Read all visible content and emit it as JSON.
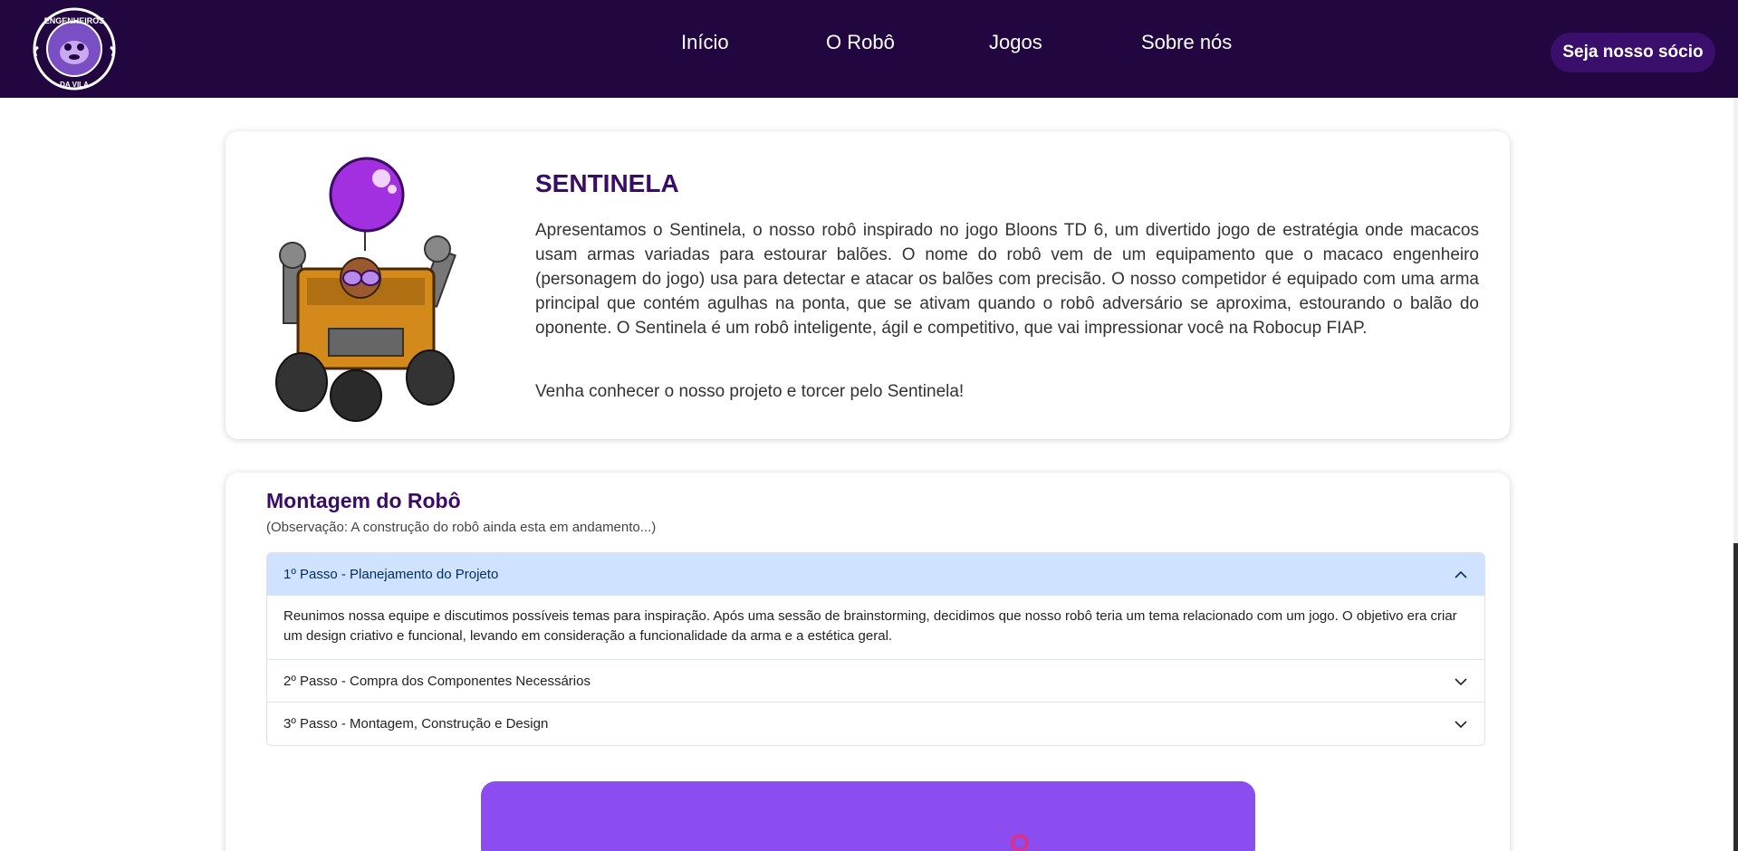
{
  "nav": {
    "logo_text_top": "ENGENHEIROS",
    "logo_text_bottom": "DA VILA",
    "links": [
      "Início",
      "O Robô",
      "Jogos",
      "Sobre nós"
    ],
    "cta_label": "Seja nosso sócio"
  },
  "robot": {
    "title": "SENTINELA",
    "description": "Apresentamos o Sentinela, o nosso robô inspirado no jogo Bloons TD 6, um divertido jogo de estratégia onde macacos usam armas variadas para estourar balões. O nome do robô vem de um equipamento que o macaco engenheiro (personagem do jogo) usa para detectar e atacar os balões com precisão. O nosso competidor é equipado com uma arma principal que contém agulhas na ponta, que se ativam quando o robô adversário se aproxima, estourando o balão do oponente. O Sentinela é um robô inteligente, ágil e competitivo, que vai impressionar você na Robocup FIAP.",
    "invite": "Venha conhecer o nosso projeto e torcer pelo Sentinela!"
  },
  "build": {
    "title": "Montagem do Robô",
    "note": "(Observação: A construção do robô ainda esta em andamento...)",
    "steps": [
      {
        "label": "1º Passo - Planejamento do Projeto",
        "open": true,
        "body": "Reunimos nossa equipe e discutimos possíveis temas para inspiração. Após uma sessão de brainstorming, decidimos que nosso robô teria um tema relacionado com um jogo. O objetivo era criar um design criativo e funcional, levando em consideração a funcionalidade da arma e a estética geral."
      },
      {
        "label": "2º Passo - Compra dos Componentes Necessários",
        "open": false
      },
      {
        "label": "3º Passo - Montagem, Construção e Design",
        "open": false
      }
    ]
  },
  "colors": {
    "nav_bg": "#220640",
    "accent_purple": "#3b0c66",
    "accordion_open_bg": "#cfe2ff",
    "banner_purple": "#8b4cf0"
  }
}
